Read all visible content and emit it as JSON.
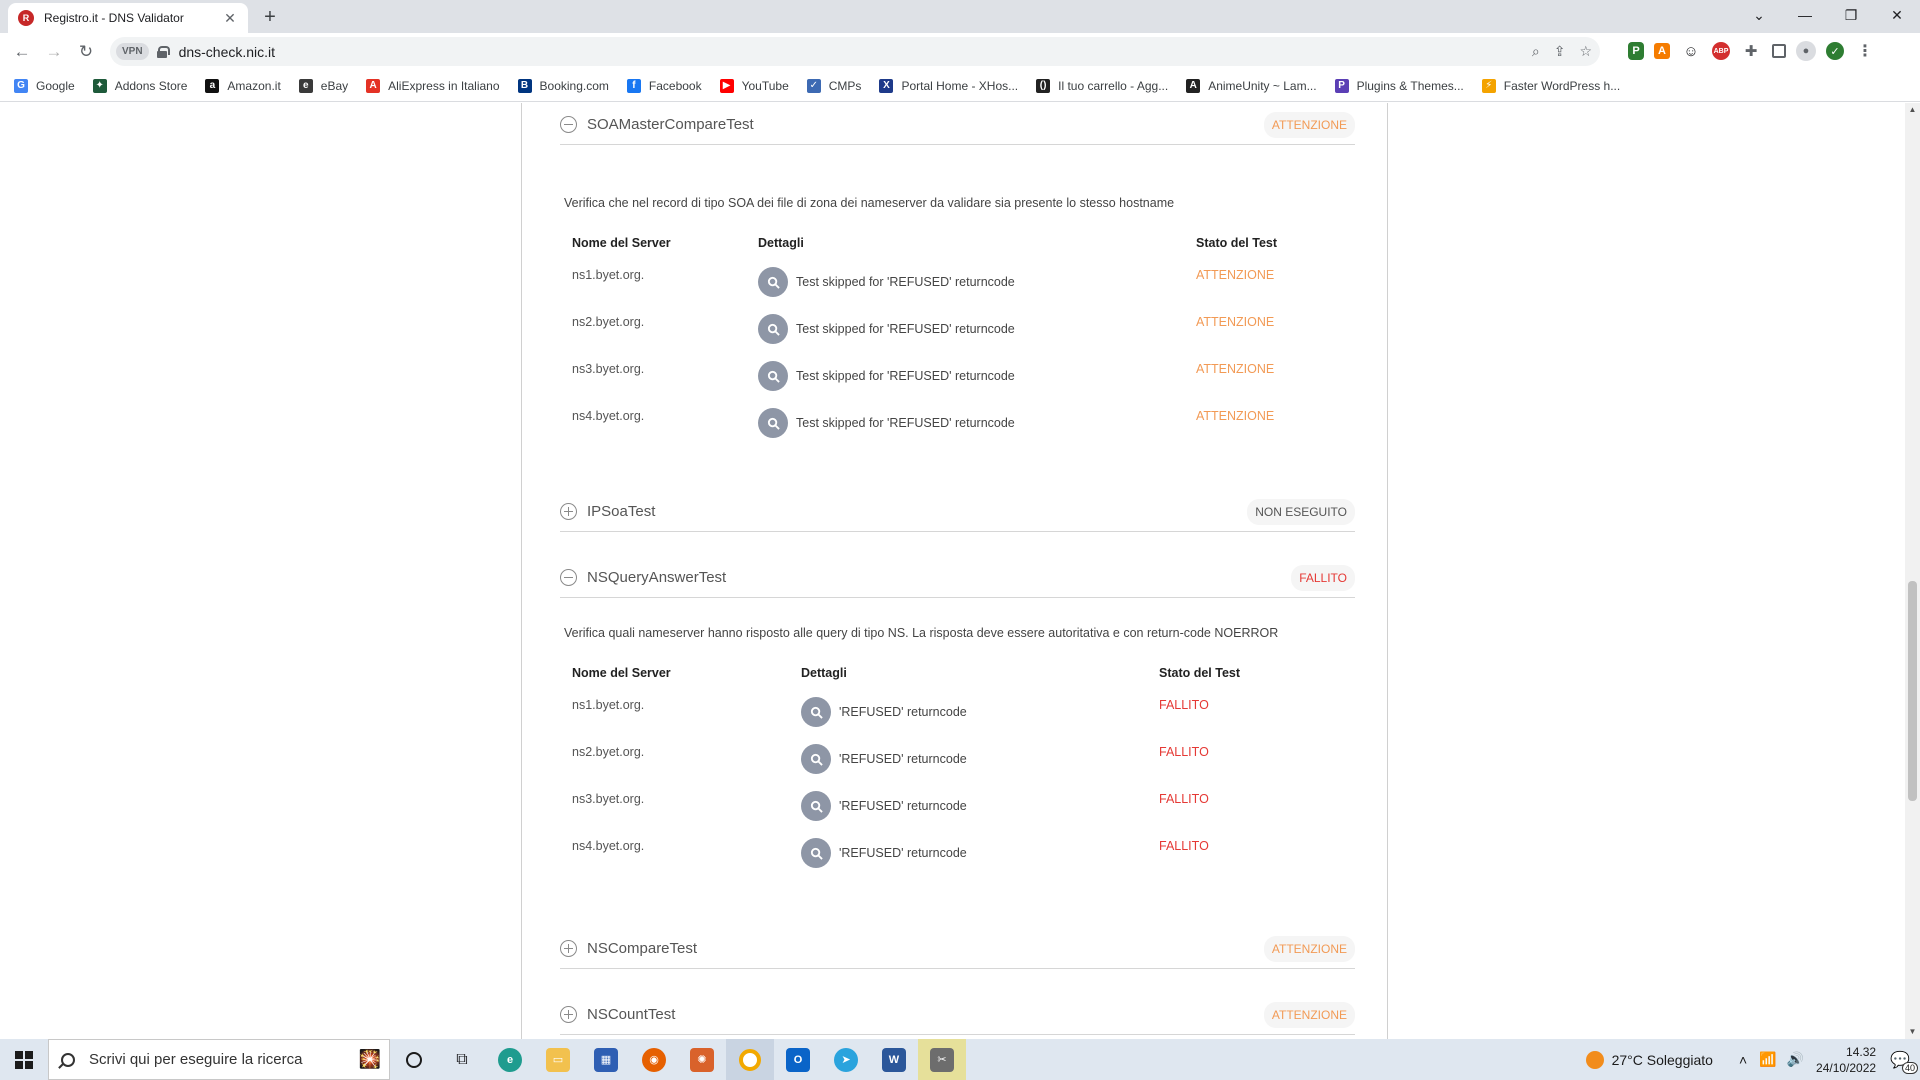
{
  "browser": {
    "tab_title": "Registro.it - DNS Validator",
    "tab_close": "✕",
    "new_tab": "+",
    "vpn_label": "VPN",
    "url": "dns-check.nic.it",
    "bookmarks": [
      {
        "label": "Google",
        "icon": "google-icon",
        "color": "#4285f4",
        "glyph": "G"
      },
      {
        "label": "Addons Store",
        "icon": "addons-store-icon",
        "color": "#1e5a3a",
        "glyph": "✦"
      },
      {
        "label": "Amazon.it",
        "icon": "amazon-icon",
        "color": "#111111",
        "glyph": "a"
      },
      {
        "label": "eBay",
        "icon": "ebay-icon",
        "color": "#3a3a3a",
        "glyph": "e"
      },
      {
        "label": "AliExpress in Italiano",
        "icon": "aliexpress-icon",
        "color": "#e43225",
        "glyph": "A"
      },
      {
        "label": "Booking.com",
        "icon": "booking-icon",
        "color": "#003580",
        "glyph": "B"
      },
      {
        "label": "Facebook",
        "icon": "facebook-icon",
        "color": "#1877f2",
        "glyph": "f"
      },
      {
        "label": "YouTube",
        "icon": "youtube-icon",
        "color": "#ff0000",
        "glyph": "▶"
      },
      {
        "label": "CMPs",
        "icon": "cmps-icon",
        "color": "#3d6ab3",
        "glyph": "✓"
      },
      {
        "label": "Portal Home - XHos...",
        "icon": "xhost-icon",
        "color": "#1e3a8a",
        "glyph": "X"
      },
      {
        "label": "Il tuo carrello - Agg...",
        "icon": "cart-icon",
        "color": "#222222",
        "glyph": "()"
      },
      {
        "label": "AnimeUnity ~ Lam...",
        "icon": "animeunity-icon",
        "color": "#222222",
        "glyph": "A"
      },
      {
        "label": "Plugins & Themes...",
        "icon": "plugins-icon",
        "color": "#5b3fb5",
        "glyph": "P"
      },
      {
        "label": "Faster WordPress h...",
        "icon": "lightning-icon",
        "color": "#f4a300",
        "glyph": "⚡"
      }
    ]
  },
  "sections": [
    {
      "name": "SOAMasterCompareTest",
      "status": "ATTENZIONE",
      "expanded": true,
      "description": "Verifica che nel record di tipo SOA dei file di zona dei nameserver da validare sia presente lo stesso hostname",
      "headers": {
        "server": "Nome del Server",
        "details": "Dettagli",
        "status": "Stato del Test"
      },
      "rows": [
        {
          "server": "ns1.byet.org.",
          "detail": "Test skipped for 'REFUSED' returncode",
          "status": "ATTENZIONE"
        },
        {
          "server": "ns2.byet.org.",
          "detail": "Test skipped for 'REFUSED' returncode",
          "status": "ATTENZIONE"
        },
        {
          "server": "ns3.byet.org.",
          "detail": "Test skipped for 'REFUSED' returncode",
          "status": "ATTENZIONE"
        },
        {
          "server": "ns4.byet.org.",
          "detail": "Test skipped for 'REFUSED' returncode",
          "status": "ATTENZIONE"
        }
      ]
    },
    {
      "name": "IPSoaTest",
      "status": "NON ESEGUITO",
      "expanded": false
    },
    {
      "name": "NSQueryAnswerTest",
      "status": "FALLITO",
      "expanded": true,
      "description": "Verifica quali nameserver hanno risposto alle query di tipo NS. La risposta deve essere autoritativa e con return-code NOERROR",
      "headers": {
        "server": "Nome del Server",
        "details": "Dettagli",
        "status": "Stato del Test"
      },
      "rows": [
        {
          "server": "ns1.byet.org.",
          "detail": "'REFUSED' returncode",
          "status": "FALLITO"
        },
        {
          "server": "ns2.byet.org.",
          "detail": "'REFUSED' returncode",
          "status": "FALLITO"
        },
        {
          "server": "ns3.byet.org.",
          "detail": "'REFUSED' returncode",
          "status": "FALLITO"
        },
        {
          "server": "ns4.byet.org.",
          "detail": "'REFUSED' returncode",
          "status": "FALLITO"
        }
      ]
    },
    {
      "name": "NSCompareTest",
      "status": "ATTENZIONE",
      "expanded": false
    },
    {
      "name": "NSCountTest",
      "status": "ATTENZIONE",
      "expanded": false
    }
  ],
  "taskbar": {
    "search_placeholder": "Scrivi qui per eseguire la ricerca",
    "weather": "27°C  Soleggiato",
    "time": "14.32",
    "date": "24/10/2022",
    "notifications": "40"
  },
  "colors": {
    "warning": "#f29a55",
    "failed": "#e53935",
    "neutral": "#555555"
  }
}
